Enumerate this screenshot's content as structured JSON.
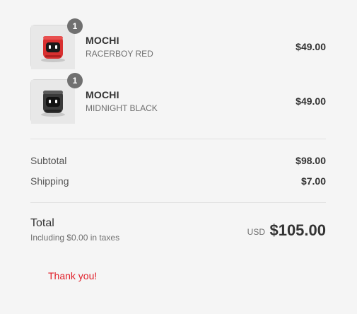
{
  "items": [
    {
      "quantity": "1",
      "name": "MOCHI",
      "variant": "RACERBOY RED",
      "price": "$49.00",
      "image_icon": "red-robot-figure",
      "color": "#d83030"
    },
    {
      "quantity": "1",
      "name": "MOCHI",
      "variant": "MIDNIGHT BLACK",
      "price": "$49.00",
      "image_icon": "black-robot-figure",
      "color": "#3a3a3a"
    }
  ],
  "summary": {
    "subtotal_label": "Subtotal",
    "subtotal_value": "$98.00",
    "shipping_label": "Shipping",
    "shipping_value": "$7.00"
  },
  "total": {
    "label": "Total",
    "tax_note": "Including $0.00 in taxes",
    "currency": "USD",
    "value": "$105.00"
  },
  "thank_you": "Thank you!",
  "colors": {
    "background": "#f5f5f5",
    "accent_red": "#e0202a",
    "badge": "#707070"
  }
}
